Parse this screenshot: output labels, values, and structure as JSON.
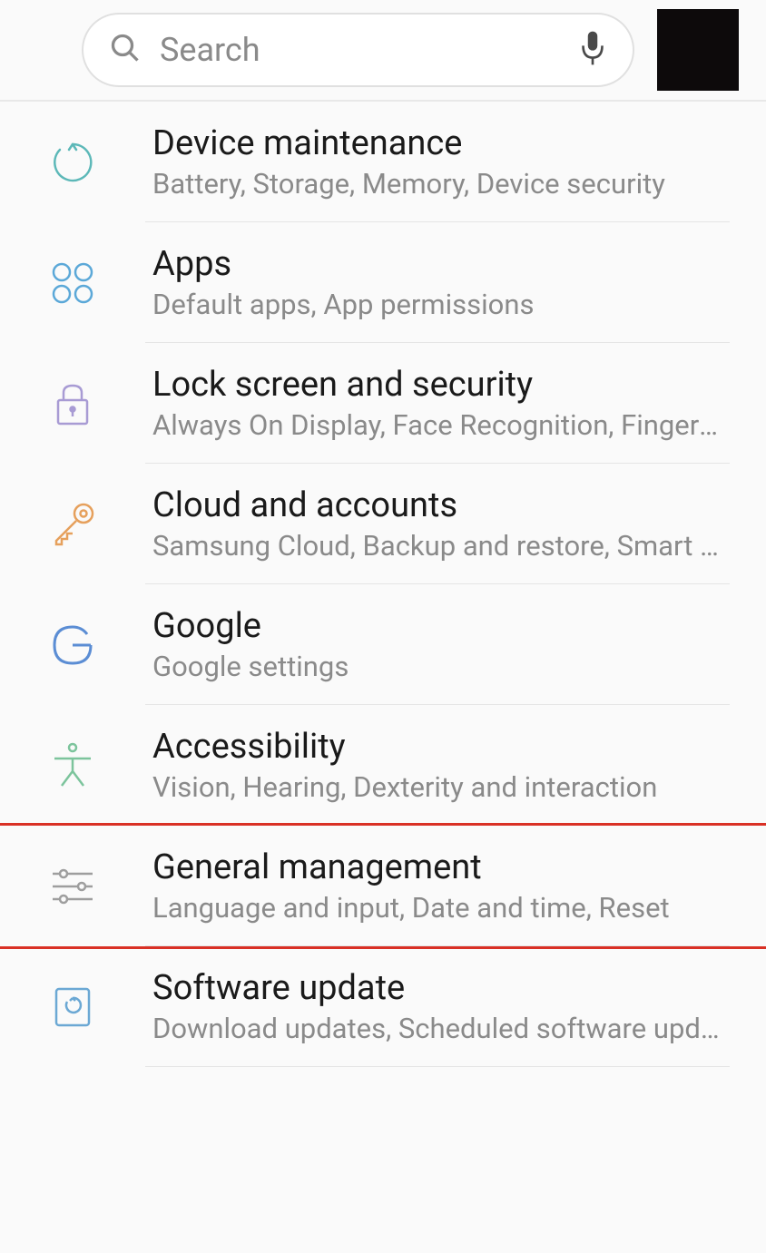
{
  "search": {
    "placeholder": "Search"
  },
  "items": [
    {
      "title": "Device maintenance",
      "subtitle": "Battery, Storage, Memory, Device security"
    },
    {
      "title": "Apps",
      "subtitle": "Default apps, App permissions"
    },
    {
      "title": "Lock screen and security",
      "subtitle": "Always On Display, Face Recognition, Fingerprint scanner"
    },
    {
      "title": "Cloud and accounts",
      "subtitle": "Samsung Cloud, Backup and restore, Smart Switch"
    },
    {
      "title": "Google",
      "subtitle": "Google settings"
    },
    {
      "title": "Accessibility",
      "subtitle": "Vision, Hearing, Dexterity and interaction"
    },
    {
      "title": "General management",
      "subtitle": "Language and input, Date and time, Reset"
    },
    {
      "title": "Software update",
      "subtitle": "Download updates, Scheduled software updates"
    }
  ]
}
